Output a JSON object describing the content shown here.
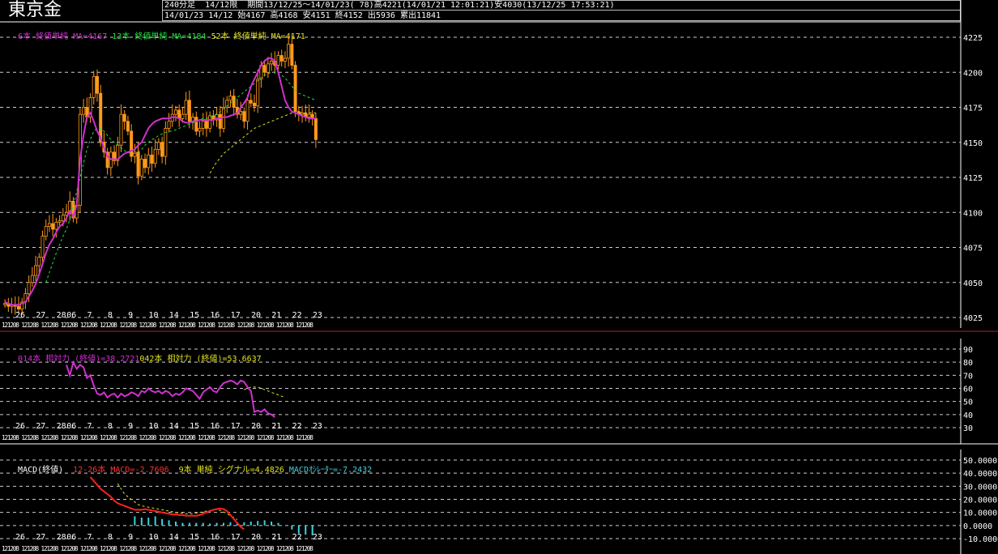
{
  "header": {
    "title": "東京金",
    "period_label": "240分足  14/12限",
    "period_range": "期間13/12/25～14/01/23( 78)",
    "high_info": "高4221(14/01/21 12:01:21)",
    "low_info": "安4030(13/12/25 17:53:21)",
    "date": "14/01/23",
    "contract": "14/12",
    "open": "始4167",
    "high": "高4168",
    "low": "安4151",
    "close": "終4152",
    "volume": "出5936",
    "cumulative": "累出11841"
  },
  "legends": {
    "price": [
      {
        "text": "6本 終値単純 MA=4167",
        "color": "#d030d0"
      },
      {
        "text": "13本 終値単純 MA=4184",
        "color": "#20e040"
      },
      {
        "text": "52本 終値単純 MA=4171",
        "color": "#e0e020"
      }
    ],
    "rsi": [
      {
        "text": "014本 相対力 (終値)=38.2721",
        "color": "#d030d0"
      },
      {
        "text": "042本 相対力 (終値)=53.6637",
        "color": "#e0e020"
      }
    ],
    "macd": [
      {
        "text": "MACD(終値)",
        "color": "#ffffff"
      },
      {
        "text": "12-26本 MACD=-2.7606",
        "color": "#ff3030"
      },
      {
        "text": "9本 単純 シグナル=4.4826",
        "color": "#e0e020"
      },
      {
        "text": "MACDｵｼﾚｰﾀｰ=-7.2432",
        "color": "#40d0e0"
      }
    ]
  },
  "x_date_labels": [
    {
      "label": "26",
      "i": 4
    },
    {
      "label": "27",
      "i": 10
    },
    {
      "label": "28",
      "i": 16
    },
    {
      "label": "06",
      "i": 19
    },
    {
      "label": "7",
      "i": 25
    },
    {
      "label": "8",
      "i": 31
    },
    {
      "label": "9",
      "i": 37
    },
    {
      "label": "10",
      "i": 43
    },
    {
      "label": "14",
      "i": 49
    },
    {
      "label": "15",
      "i": 55
    },
    {
      "label": "16",
      "i": 61
    },
    {
      "label": "17",
      "i": 67
    },
    {
      "label": "20",
      "i": 73
    },
    {
      "label": "21",
      "i": 79
    },
    {
      "label": "22",
      "i": 85
    },
    {
      "label": "23",
      "i": 91
    }
  ],
  "x_time_label": "1208",
  "colors": {
    "candle": "#ff9a1a",
    "ma6": "#d030d0",
    "ma13": "#20e040",
    "ma52": "#e0e020",
    "macd": "#ff2020",
    "signal": "#e0e020",
    "osc": "#40d0e0",
    "grid": "#ffffff",
    "divider": "#b0203a"
  },
  "chart_data": [
    {
      "type": "candlestick",
      "name": "price",
      "ylim": [
        4025,
        4225
      ],
      "y_ticks": [
        4025,
        4050,
        4075,
        4100,
        4125,
        4150,
        4175,
        4200,
        4225
      ],
      "close": [
        4035,
        4033,
        4034,
        4033,
        4031,
        4036,
        4042,
        4050,
        4055,
        4062,
        4068,
        4083,
        4090,
        4092,
        4088,
        4093,
        4094,
        4098,
        4100,
        4108,
        4096,
        4105,
        4170,
        4175,
        4168,
        4182,
        4197,
        4185,
        4150,
        4143,
        4132,
        4143,
        4137,
        4148,
        4170,
        4165,
        4158,
        4140,
        4143,
        4126,
        4138,
        4132,
        4141,
        4135,
        4145,
        4150,
        4140,
        4160,
        4165,
        4170,
        4173,
        4167,
        4170,
        4180,
        4165,
        4168,
        4158,
        4160,
        4165,
        4160,
        4169,
        4166,
        4170,
        4160,
        4175,
        4180,
        4183,
        4175,
        4170,
        4172,
        4165,
        4180,
        4178,
        4176,
        4195,
        4205,
        4200,
        4206,
        4208,
        4205,
        4212,
        4208,
        4210,
        4220,
        4205,
        4172,
        4170,
        4171,
        4168,
        4170,
        4167,
        4152
      ],
      "ma6": [
        4036,
        4035,
        4034,
        4034,
        4034,
        4035,
        4036,
        4040,
        4044,
        4049,
        4056,
        4063,
        4071,
        4077,
        4081,
        4086,
        4090,
        4092,
        4096,
        4101,
        4097,
        4105,
        4138,
        4155,
        4168,
        4171,
        4165,
        4158,
        4153,
        4146,
        4140,
        4138,
        4138,
        4138,
        4140,
        4142,
        4143,
        4144,
        4145,
        4148,
        4150,
        4155,
        4160,
        4163,
        4165,
        4166,
        4167,
        4167,
        4167,
        4168,
        4168,
        4167,
        4165,
        4164,
        4164,
        4165,
        4165,
        4166,
        4166,
        4166,
        4166,
        4166,
        4167,
        4167,
        4168,
        4168,
        4169,
        4170,
        4171,
        4175,
        4178,
        4182,
        4190,
        4195,
        4200,
        4205,
        4208,
        4210,
        4210,
        4208,
        4200,
        4190,
        4180,
        4175,
        4172,
        4171,
        4170,
        4169,
        4168,
        4167,
        4167,
        4167
      ],
      "ma13": [
        null,
        null,
        null,
        null,
        null,
        null,
        null,
        null,
        null,
        null,
        null,
        null,
        4050,
        4057,
        4064,
        4071,
        4077,
        4083,
        4088,
        4095,
        4105,
        4115,
        4125,
        4135,
        4145,
        4152,
        4158,
        4160,
        4160,
        4158,
        4155,
        4152,
        4150,
        4148,
        4146,
        4144,
        4143,
        4142,
        4142,
        4143,
        4145,
        4148,
        4150,
        4152,
        4153,
        4155,
        4156,
        4157,
        4158,
        4158,
        4159,
        4160,
        4161,
        4162,
        4163,
        4164,
        4165,
        4166,
        4167,
        4167,
        4168,
        4169,
        4170,
        4172,
        4174,
        4176,
        4178,
        4180,
        4182,
        4184,
        4186,
        4188,
        4190,
        4192,
        4194,
        4196,
        4198,
        4199,
        4200,
        4200,
        4199,
        4198,
        4196,
        4193,
        4190,
        4187,
        4185,
        4184,
        4183,
        4182,
        4181,
        4180
      ],
      "ma52": [
        null,
        null,
        null,
        null,
        null,
        null,
        null,
        null,
        null,
        null,
        null,
        null,
        null,
        null,
        null,
        null,
        null,
        null,
        null,
        null,
        null,
        null,
        null,
        null,
        null,
        null,
        null,
        null,
        null,
        null,
        null,
        null,
        null,
        null,
        null,
        null,
        null,
        null,
        null,
        null,
        null,
        null,
        null,
        null,
        null,
        null,
        null,
        null,
        null,
        null,
        null,
        null,
        null,
        null,
        null,
        null,
        null,
        null,
        null,
        null,
        4128,
        4132,
        4136,
        4139,
        4142,
        4144,
        4146,
        4148,
        4150,
        4152,
        4154,
        4156,
        4158,
        4160,
        4161,
        4162,
        4163,
        4164,
        4165,
        4166,
        4167,
        4168,
        4169,
        4170,
        4171,
        4171,
        4171,
        4171,
        4171,
        4171,
        4171,
        4171
      ]
    },
    {
      "type": "line",
      "name": "rsi",
      "ylim": [
        30,
        90
      ],
      "y_ticks": [
        30,
        40,
        50,
        60,
        70,
        80,
        90
      ],
      "rsi14": [
        null,
        null,
        null,
        null,
        null,
        null,
        null,
        null,
        null,
        null,
        null,
        null,
        null,
        null,
        null,
        null,
        null,
        null,
        78,
        70,
        80,
        75,
        78,
        76,
        68,
        70,
        62,
        56,
        55,
        57,
        53,
        55,
        56,
        53,
        56,
        54,
        55,
        57,
        56,
        54,
        58,
        57,
        60,
        58,
        57,
        58,
        56,
        58,
        57,
        54,
        56,
        55,
        57,
        60,
        59,
        58,
        55,
        52,
        57,
        59,
        61,
        58,
        57,
        61,
        64,
        65,
        66,
        65,
        63,
        66,
        65,
        61,
        58,
        42,
        43,
        42,
        44,
        41,
        40,
        38
      ],
      "rsi42": [
        null,
        null,
        null,
        null,
        null,
        null,
        null,
        null,
        null,
        null,
        null,
        null,
        null,
        null,
        null,
        null,
        null,
        null,
        null,
        null,
        null,
        null,
        null,
        null,
        null,
        null,
        null,
        null,
        null,
        null,
        null,
        null,
        null,
        null,
        null,
        null,
        null,
        null,
        null,
        null,
        null,
        null,
        null,
        null,
        null,
        null,
        null,
        null,
        null,
        null,
        null,
        null,
        null,
        null,
        null,
        null,
        null,
        null,
        null,
        null,
        null,
        null,
        null,
        null,
        null,
        null,
        null,
        null,
        null,
        null,
        59,
        60,
        61,
        61,
        61,
        60,
        59,
        58,
        57,
        56,
        55,
        54,
        53
      ]
    },
    {
      "type": "line",
      "name": "macd",
      "ylim": [
        -10,
        50
      ],
      "y_ticks": [
        -10,
        0,
        10,
        20,
        30,
        40,
        50
      ],
      "macd": [
        null,
        null,
        null,
        null,
        null,
        null,
        null,
        null,
        null,
        null,
        null,
        null,
        null,
        null,
        null,
        null,
        null,
        null,
        null,
        null,
        null,
        null,
        null,
        null,
        null,
        37,
        34,
        31,
        28,
        26,
        24,
        22,
        19,
        17,
        16,
        15,
        14,
        13,
        12,
        12,
        12,
        12.5,
        12,
        11.5,
        11,
        10.5,
        10,
        9.5,
        9,
        8.5,
        8.5,
        8,
        8,
        7.5,
        7.5,
        7.5,
        7.5,
        8,
        9,
        10,
        11,
        12,
        12.5,
        13,
        12.5,
        11,
        8,
        5,
        2,
        -1,
        -2.8
      ],
      "signal": [
        null,
        null,
        null,
        null,
        null,
        null,
        null,
        null,
        null,
        null,
        null,
        null,
        null,
        null,
        null,
        null,
        null,
        null,
        null,
        null,
        null,
        null,
        null,
        null,
        null,
        null,
        null,
        null,
        null,
        null,
        null,
        null,
        null,
        32,
        28,
        24,
        22,
        20,
        18,
        16,
        15,
        14.5,
        14,
        13.5,
        13,
        12.5,
        12,
        11.5,
        11,
        10.5,
        10,
        9.5,
        9.5,
        9,
        9,
        9,
        9.5,
        10,
        10.5,
        11,
        11.5,
        12,
        12,
        11.5,
        10.5,
        9,
        7.5,
        6,
        4.5
      ],
      "osc": [
        null,
        null,
        null,
        null,
        null,
        null,
        null,
        null,
        null,
        null,
        null,
        null,
        null,
        null,
        null,
        null,
        null,
        null,
        null,
        null,
        null,
        null,
        null,
        null,
        null,
        null,
        null,
        null,
        null,
        null,
        null,
        null,
        null,
        null,
        null,
        null,
        null,
        null,
        null,
        null,
        null,
        null,
        null,
        null,
        null,
        null,
        null,
        null,
        null,
        null,
        null,
        null,
        null,
        null,
        null,
        null,
        null,
        null,
        null,
        null,
        null,
        null,
        null,
        null,
        null,
        null,
        null,
        null,
        null,
        null,
        null,
        null,
        null,
        null,
        null,
        null,
        null,
        null,
        null,
        null,
        null,
        null,
        null,
        null,
        null,
        null,
        null,
        null,
        null,
        null,
        null,
        null
      ]
    }
  ],
  "macd_osc_bars": [
    {
      "i": 38,
      "v": 7
    },
    {
      "i": 40,
      "v": 6
    },
    {
      "i": 42,
      "v": 6
    },
    {
      "i": 44,
      "v": 7
    },
    {
      "i": 46,
      "v": 5
    },
    {
      "i": 48,
      "v": 4
    },
    {
      "i": 50,
      "v": 3
    },
    {
      "i": 52,
      "v": 2
    },
    {
      "i": 54,
      "v": 2
    },
    {
      "i": 56,
      "v": 2
    },
    {
      "i": 58,
      "v": 2
    },
    {
      "i": 60,
      "v": 1.5
    },
    {
      "i": 62,
      "v": 2
    },
    {
      "i": 64,
      "v": 2
    },
    {
      "i": 66,
      "v": 2.5
    },
    {
      "i": 68,
      "v": 2
    },
    {
      "i": 70,
      "v": 2.5
    },
    {
      "i": 72,
      "v": 3
    },
    {
      "i": 74,
      "v": 3.5
    },
    {
      "i": 76,
      "v": 4
    },
    {
      "i": 78,
      "v": 3
    },
    {
      "i": 80,
      "v": 2
    },
    {
      "i": 84,
      "v": -3
    },
    {
      "i": 86,
      "v": -6
    },
    {
      "i": 88,
      "v": -7
    },
    {
      "i": 90,
      "v": -7.5
    }
  ]
}
